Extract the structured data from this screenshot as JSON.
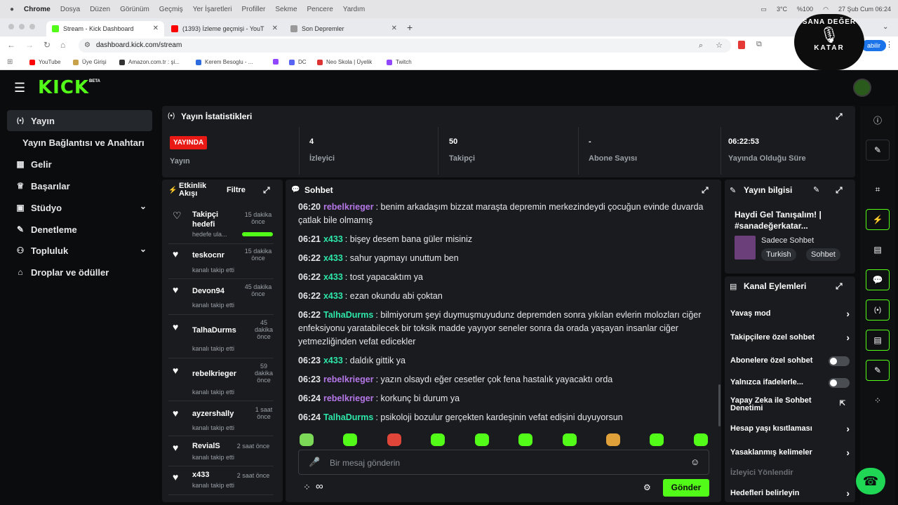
{
  "menubar": {
    "app": "Chrome",
    "items": [
      "Dosya",
      "Düzen",
      "Görünüm",
      "Geçmiş",
      "Yer İşaretleri",
      "Profiller",
      "Sekme",
      "Pencere",
      "Yardım"
    ],
    "weather": "3°C",
    "battery": "%100",
    "datetime": "27 Şub Cum  06:24"
  },
  "tabs": [
    {
      "title": "Stream - Kick Dashboard",
      "color": "#53fc18"
    },
    {
      "title": "(1393) İzleme geçmişi - YouT",
      "color": "#ff0000"
    },
    {
      "title": "Son Depremler",
      "color": "#888888"
    }
  ],
  "address": {
    "url": "dashboard.kick.com/stream",
    "update_label": "abilir"
  },
  "bookmarks": [
    {
      "label": "YouTube",
      "color": "#ff0000"
    },
    {
      "label": "Üye Girişi",
      "color": "#c8a24a"
    },
    {
      "label": "Amazon.com.tr : şi...",
      "color": "#333333"
    },
    {
      "label": "Kerem Besoglu - ...",
      "color": "#2d6cdf"
    },
    {
      "label": "",
      "color": "#9146ff"
    },
    {
      "label": "DC",
      "color": "#5865f2"
    },
    {
      "label": "Neo Skola | Üyelik",
      "color": "#d33333"
    },
    {
      "label": "Twitch",
      "color": "#9146ff"
    }
  ],
  "overlay_logo": {
    "top": "SANA DEĞER",
    "bottom": "KATAR"
  },
  "kick": {
    "logo": "KICK",
    "beta": "BETA"
  },
  "sidebar": {
    "items": [
      {
        "label": "Yayın",
        "icon": "broadcast-icon",
        "glyph": "((·))"
      },
      {
        "label": "Yayın Bağlantısı ve Anahtarı",
        "icon": "",
        "glyph": ""
      },
      {
        "label": "Gelir",
        "icon": "dollar-icon",
        "glyph": "▦"
      },
      {
        "label": "Başarılar",
        "icon": "trophy-icon",
        "glyph": "🏆"
      },
      {
        "label": "Stüdyo",
        "icon": "studio-icon",
        "glyph": "▣"
      },
      {
        "label": "Denetleme",
        "icon": "wrench-icon",
        "glyph": "🔧"
      },
      {
        "label": "Topluluk",
        "icon": "users-icon",
        "glyph": "👥"
      },
      {
        "label": "Droplar ve ödüller",
        "icon": "gift-icon",
        "glyph": "🎁"
      }
    ]
  },
  "stats": {
    "title": "Yayın İstatistikleri",
    "live_badge": "YAYINDA",
    "live_label": "Yayın",
    "viewers_value": "4",
    "viewers_label": "İzleyici",
    "followers_value": "50",
    "followers_label": "Takipçi",
    "subs_value": "-",
    "subs_label": "Abone Sayısı",
    "uptime_value": "06:22:53",
    "uptime_label": "Yayında Olduğu Süre"
  },
  "activity": {
    "title_line1": "Etkinlik",
    "title_line2": "Akışı",
    "filter": "Filtre",
    "events": [
      {
        "name": "Takipçi hedefi",
        "time": "15 dakika önce",
        "sub": "hedefe ula..."
      },
      {
        "name": "teskocnr",
        "time": "15 dakika önce",
        "sub": "kanalı takip etti"
      },
      {
        "name": "Devon94",
        "time": "45 dakika önce",
        "sub": "kanalı takip etti"
      },
      {
        "name": "TalhaDurms",
        "time": "45 dakika önce",
        "sub": "kanalı takip etti"
      },
      {
        "name": "rebelkrieger",
        "time": "59 dakika önce",
        "sub": "kanalı takip etti"
      },
      {
        "name": "ayzershally",
        "time": "1 saat önce",
        "sub": "kanalı takip etti"
      },
      {
        "name": "RevialS",
        "time": "2 saat önce",
        "sub": "kanalı takip etti"
      },
      {
        "name": "x433",
        "time": "2 saat önce",
        "sub": "kanalı takip etti"
      }
    ],
    "goal_progress": 1.0
  },
  "chat": {
    "title": "Sohbet",
    "messages": [
      {
        "time": "06:20",
        "user": "rebelkrieger",
        "color": "#b678e8",
        "text": "benim arkadaşım bizzat maraşta depremin merkezindeydi çocuğun evinde duvarda çatlak bile olmamış"
      },
      {
        "time": "06:21",
        "user": "x433",
        "color": "#2ee6a8",
        "text": "bişey desem bana güler misiniz"
      },
      {
        "time": "06:22",
        "user": "x433",
        "color": "#2ee6a8",
        "text": "sahur yapmayı unuttum ben"
      },
      {
        "time": "06:22",
        "user": "x433",
        "color": "#2ee6a8",
        "text": "tost yapacaktım ya"
      },
      {
        "time": "06:22",
        "user": "x433",
        "color": "#2ee6a8",
        "text": "ezan okundu abi çoktan"
      },
      {
        "time": "06:22",
        "user": "TalhaDurms",
        "color": "#2ee6a8",
        "text": "bilmiyorum şeyi duymuşmuyudunz depremden sonra yıkılan evlerin molozları ciğer enfeksiyonu yaratabilecek bir toksik madde yayıyor seneler sonra da orada yaşayan insanlar ciğer yetmezliğinden vefat edicekler"
      },
      {
        "time": "06:23",
        "user": "x433",
        "color": "#2ee6a8",
        "text": "daldık gittik ya"
      },
      {
        "time": "06:23",
        "user": "rebelkrieger",
        "color": "#b678e8",
        "text": "yazın olsaydı eğer cesetler çok fena hastalık yayacaktı orda"
      },
      {
        "time": "06:24",
        "user": "rebelkrieger",
        "color": "#b678e8",
        "text": "korkunç bi durum ya"
      },
      {
        "time": "06:24",
        "user": "TalhaDurms",
        "color": "#2ee6a8",
        "text": "psikoloji bozulur gerçekten kardeşinin vefat edişini duyuyorsun"
      }
    ],
    "emotes": [
      "#7bd957",
      "#53fc18",
      "#e0453a",
      "#53fc18",
      "#53fc18",
      "#53fc18",
      "#53fc18",
      "#e0a03a",
      "#53fc18",
      "#53fc18"
    ],
    "input_placeholder": "Bir mesaj gönderin",
    "send_label": "Gönder"
  },
  "stream_info": {
    "title": "Yayın bilgisi",
    "stream_title": "Haydi Gel Tanışalım! | #sanadeğerkatar...",
    "category": "Sadece Sohbet",
    "tags": [
      "Turkish",
      "Sohbet"
    ]
  },
  "channel_actions": {
    "title": "Kanal Eylemleri",
    "items": [
      {
        "label": "Yavaş mod",
        "kind": "chevron"
      },
      {
        "label": "Takipçilere özel sohbet",
        "kind": "chevron"
      },
      {
        "label": "Abonelere özel sohbet",
        "kind": "toggle"
      },
      {
        "label": "Yalnızca ifadelerle...",
        "kind": "toggle"
      },
      {
        "label": "Yapay Zeka ile Sohbet Denetimi",
        "kind": "external"
      },
      {
        "label": "Hesap yaşı kısıtlaması",
        "kind": "chevron"
      },
      {
        "label": "Yasaklanmış kelimeler",
        "kind": "chevron"
      },
      {
        "label": "İzleyici Yönlendir",
        "kind": "disabled"
      },
      {
        "label": "Hedefleri belirleyin",
        "kind": "chevron"
      }
    ]
  },
  "colors": {
    "accent": "#53fc18",
    "live": "#e91916",
    "panel": "#191b1f"
  }
}
